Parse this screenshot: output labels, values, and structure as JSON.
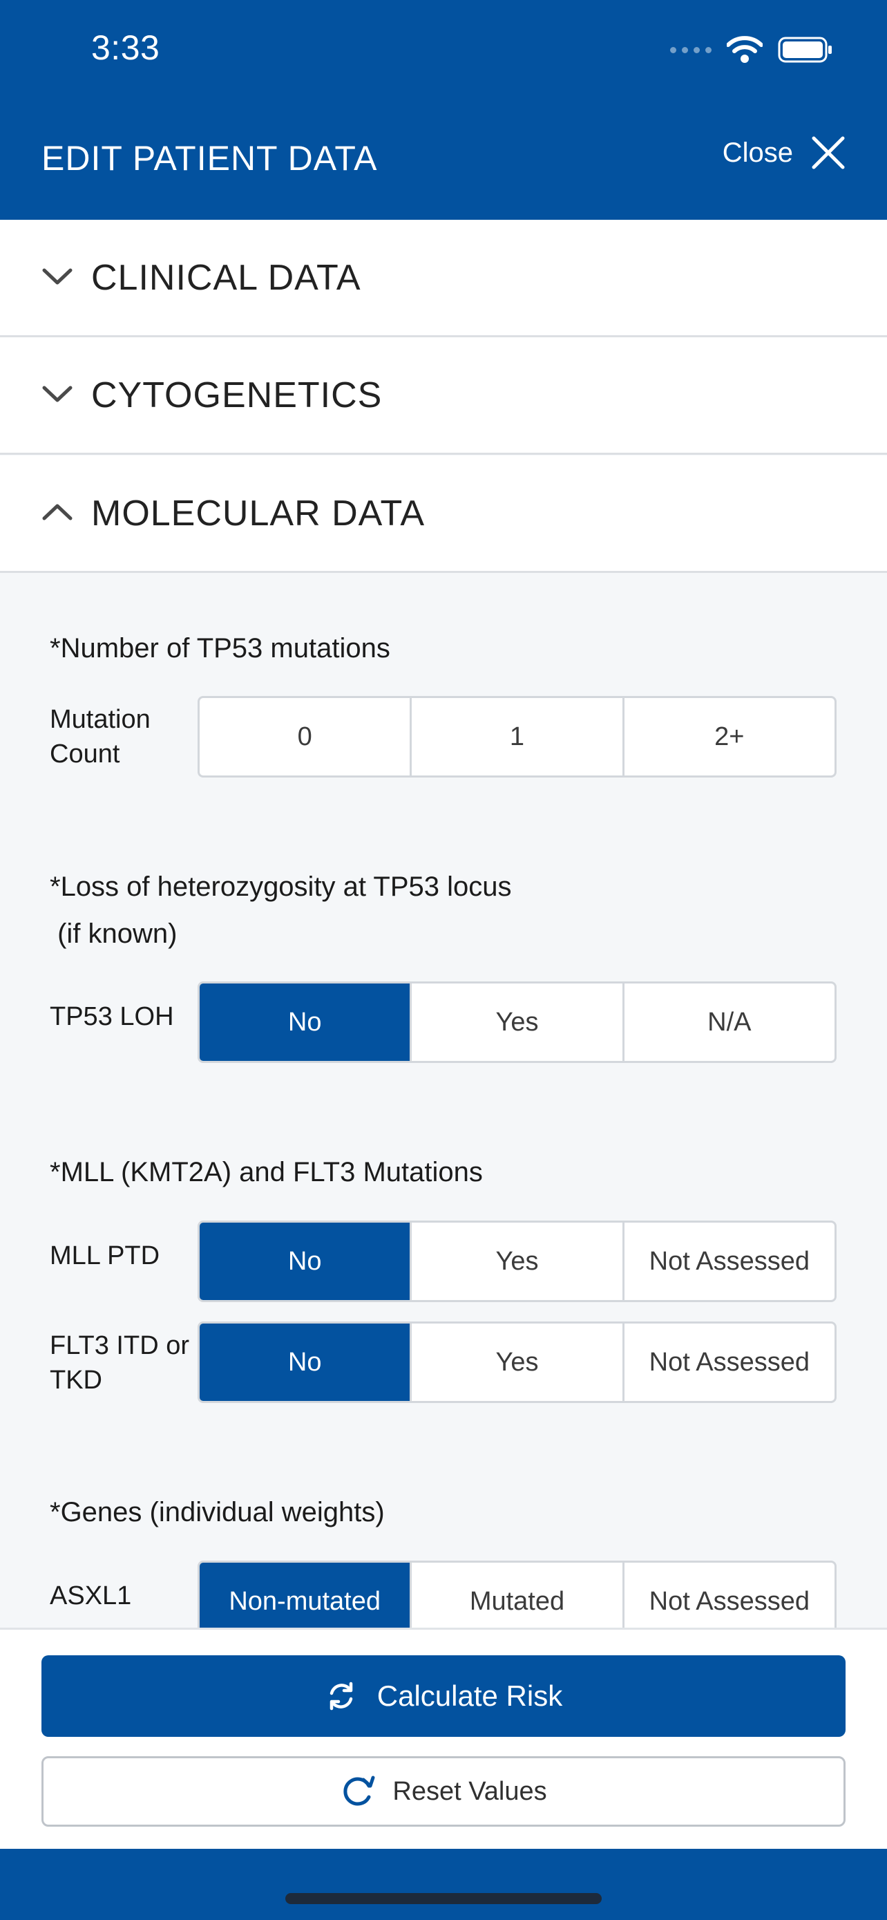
{
  "status_bar": {
    "time": "3:33"
  },
  "header": {
    "title": "EDIT PATIENT DATA",
    "close_label": "Close"
  },
  "sections": [
    {
      "label": "CLINICAL DATA",
      "expanded": false
    },
    {
      "label": "CYTOGENETICS",
      "expanded": false
    },
    {
      "label": "MOLECULAR DATA",
      "expanded": true
    }
  ],
  "molecular": {
    "tp53_count": {
      "title": "*Number of TP53 mutations",
      "row_label_line1": "Mutation",
      "row_label_line2": "Count",
      "options": [
        "0",
        "1",
        "2+"
      ],
      "selected": null
    },
    "tp53_loh": {
      "title_line1": "*Loss of heterozygosity at TP53 locus",
      "title_line2": " (if known)",
      "row_label": "TP53 LOH",
      "options": [
        "No",
        "Yes",
        "N/A"
      ],
      "selected": "No"
    },
    "mll_flt3": {
      "title": "*MLL (KMT2A) and FLT3 Mutations",
      "mll": {
        "row_label": "MLL PTD",
        "options": [
          "No",
          "Yes",
          "Not Assessed"
        ],
        "selected": "No"
      },
      "flt3": {
        "row_label_line1": "FLT3 ITD or",
        "row_label_line2": "TKD",
        "options": [
          "No",
          "Yes",
          "Not Assessed"
        ],
        "selected": "No"
      }
    },
    "genes": {
      "title": "*Genes (individual weights)",
      "asxl1": {
        "row_label": "ASXL1",
        "options": [
          "Non-mutated",
          "Mutated",
          "Not Assessed"
        ],
        "selected": "Non-mutated"
      }
    }
  },
  "footer": {
    "calculate_label": "Calculate Risk",
    "reset_label": "Reset Values"
  },
  "colors": {
    "brand": "#03529f",
    "background": "#f5f7f9"
  }
}
